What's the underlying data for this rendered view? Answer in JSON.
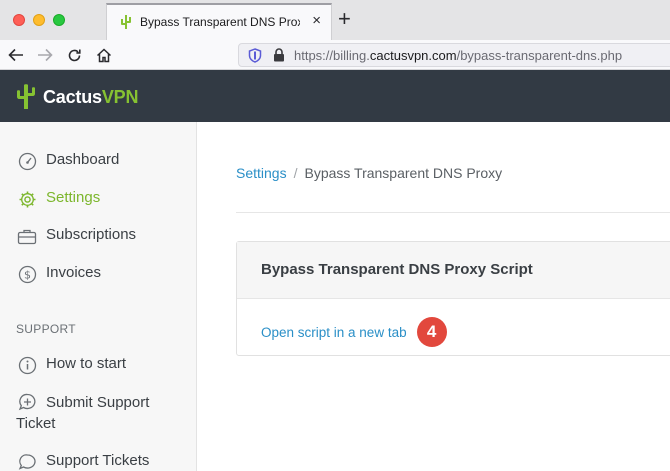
{
  "browser": {
    "tab_title": "Bypass Transparent DNS Proxy",
    "tab_close": "×",
    "new_tab": "+",
    "url_prefix": "https://billing.",
    "url_domain": "cactusvpn.com",
    "url_path": "/bypass-transparent-dns.php"
  },
  "site": {
    "logo_part1": "Cactus",
    "logo_part2": "VPN",
    "brand_color": "#86c232",
    "header_bg": "#323a44"
  },
  "sidebar": {
    "items": [
      {
        "label": "Dashboard",
        "icon": "dashboard-icon"
      },
      {
        "label": "Settings",
        "icon": "gear-icon",
        "active": true
      },
      {
        "label": "Subscriptions",
        "icon": "briefcase-icon"
      },
      {
        "label": "Invoices",
        "icon": "dollar-circle-icon"
      }
    ],
    "section_support": "SUPPORT",
    "support_items": [
      {
        "label": "How to start",
        "icon": "info-circle-icon"
      },
      {
        "label_line1": "Submit Support",
        "label_line2": "Ticket",
        "icon": "plus-bubble-icon"
      },
      {
        "label": "Support Tickets",
        "icon": "chat-bubble-icon"
      }
    ]
  },
  "breadcrumb": {
    "parent": "Settings",
    "separator": "/",
    "current": "Bypass Transparent DNS Proxy"
  },
  "card": {
    "title": "Bypass Transparent DNS Proxy Script",
    "link_text": "Open script in a new tab",
    "step_number": "4",
    "step_color": "#e2483d"
  }
}
